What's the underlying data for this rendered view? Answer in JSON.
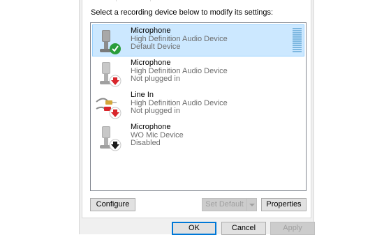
{
  "instruction": "Select a recording device below to modify its settings:",
  "devices": [
    {
      "name": "Microphone",
      "driver": "High Definition Audio Device",
      "status": "Default Device",
      "selected": true,
      "icon": "microphone-icon",
      "badge": "green-check-badge"
    },
    {
      "name": "Microphone",
      "driver": "High Definition Audio Device",
      "status": "Not plugged in",
      "selected": false,
      "icon": "microphone-icon",
      "badge": "red-down-arrow-badge"
    },
    {
      "name": "Line In",
      "driver": "High Definition Audio Device",
      "status": "Not plugged in",
      "selected": false,
      "icon": "line-in-cable-icon",
      "badge": "red-down-arrow-badge"
    },
    {
      "name": "Microphone",
      "driver": "WO Mic Device",
      "status": "Disabled",
      "selected": false,
      "icon": "microphone-icon",
      "badge": "black-down-arrow-badge"
    }
  ],
  "buttons": {
    "configure": "Configure",
    "set_default": "Set Default",
    "properties": "Properties",
    "ok": "OK",
    "cancel": "Cancel",
    "apply": "Apply"
  },
  "colors": {
    "selection": "#cce8ff",
    "selection_border": "#99d1ff",
    "level_meter": "#7db7e0",
    "check_green": "#2a9d3a",
    "arrow_red": "#d9262c"
  }
}
